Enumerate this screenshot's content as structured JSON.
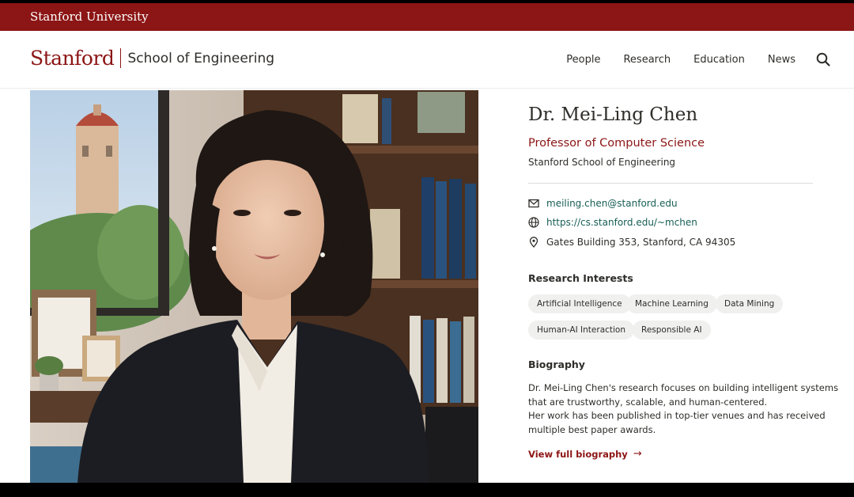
{
  "topbar": {
    "brand": "Stanford University"
  },
  "header": {
    "logo_word": "Stanford",
    "school": "School of Engineering",
    "nav": [
      "People",
      "Research",
      "Education",
      "News"
    ]
  },
  "profile": {
    "name": "Dr. Mei-Ling Chen",
    "title": "Professor of Computer Science",
    "department": "Stanford School of Engineering",
    "contact": {
      "email": "meiling.chen@stanford.edu",
      "website": "https://cs.stanford.edu/~mchen",
      "address": "Gates Building 353, Stanford, CA 94305"
    },
    "research_heading": "Research Interests",
    "interests": [
      "Artificial Intelligence",
      "Machine Learning",
      "Data Mining",
      "Human-AI Interaction",
      "Responsible AI"
    ],
    "bio_heading": "Biography",
    "bio_lines": [
      "Dr. Mei-Ling Chen's research focuses on building intelligent systems",
      "that are trustworthy, scalable, and human-centered.",
      "Her work has been published in top-tier venues and has received",
      "multiple best paper awards."
    ],
    "bio_link": "View full biography"
  },
  "colors": {
    "cardinal": "#8c1515",
    "link_green": "#175e54",
    "text": "#2e2d29"
  },
  "icons": [
    "search-icon",
    "mail-icon",
    "globe-icon",
    "location-pin-icon",
    "arrow-right-icon"
  ]
}
